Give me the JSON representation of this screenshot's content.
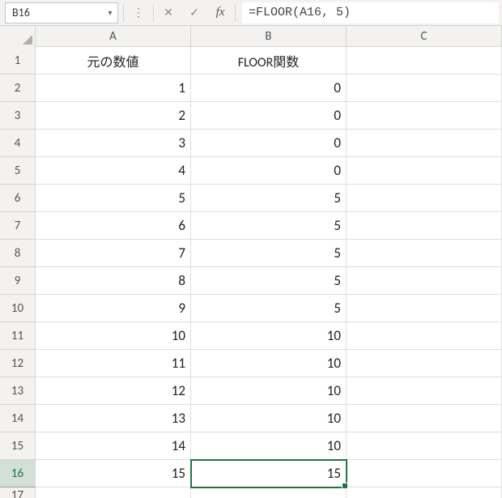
{
  "name_box": "B16",
  "formula": "=FLOOR(A16, 5)",
  "columns": [
    "A",
    "B",
    "C"
  ],
  "header_row": {
    "colA": "元の数値",
    "colB": "FLOOR関数"
  },
  "rows": [
    {
      "num": "1",
      "a": "元の数値",
      "b": "FLOOR関数",
      "is_header": true
    },
    {
      "num": "2",
      "a": "1",
      "b": "0"
    },
    {
      "num": "3",
      "a": "2",
      "b": "0"
    },
    {
      "num": "4",
      "a": "3",
      "b": "0"
    },
    {
      "num": "5",
      "a": "4",
      "b": "0"
    },
    {
      "num": "6",
      "a": "5",
      "b": "5"
    },
    {
      "num": "7",
      "a": "6",
      "b": "5"
    },
    {
      "num": "8",
      "a": "7",
      "b": "5"
    },
    {
      "num": "9",
      "a": "8",
      "b": "5"
    },
    {
      "num": "10",
      "a": "9",
      "b": "5"
    },
    {
      "num": "11",
      "a": "10",
      "b": "10"
    },
    {
      "num": "12",
      "a": "11",
      "b": "10"
    },
    {
      "num": "13",
      "a": "12",
      "b": "10"
    },
    {
      "num": "14",
      "a": "13",
      "b": "10"
    },
    {
      "num": "15",
      "a": "14",
      "b": "10"
    },
    {
      "num": "16",
      "a": "15",
      "b": "15",
      "active": true
    },
    {
      "num": "17",
      "a": "",
      "b": ""
    }
  ],
  "labels": {
    "fx": "fx"
  }
}
